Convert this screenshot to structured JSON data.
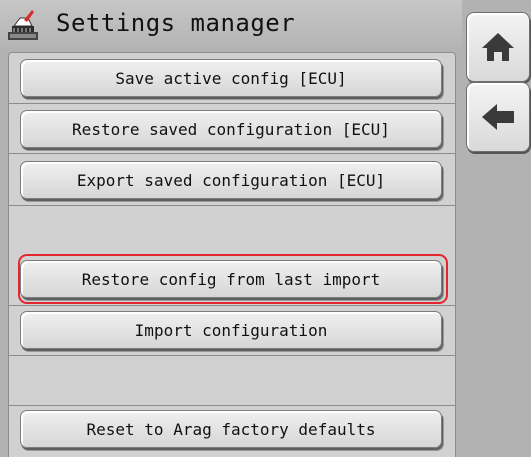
{
  "window": {
    "title": "Settings manager",
    "title_icon": "settings-brush-icon",
    "background_color": "#b2b2b2"
  },
  "buttons": {
    "save_active": "Save active config [ECU]",
    "restore_saved": "Restore saved configuration [ECU]",
    "export_saved": "Export saved configuration [ECU]",
    "restore_last_import": "Restore config from last import",
    "import_config": "Import configuration",
    "reset_factory": "Reset to Arag factory defaults"
  },
  "highlight": {
    "target": "restore_last_import",
    "color": "#e3262c"
  },
  "nav": {
    "home_icon": "home-icon",
    "back_icon": "arrow-left-icon"
  }
}
